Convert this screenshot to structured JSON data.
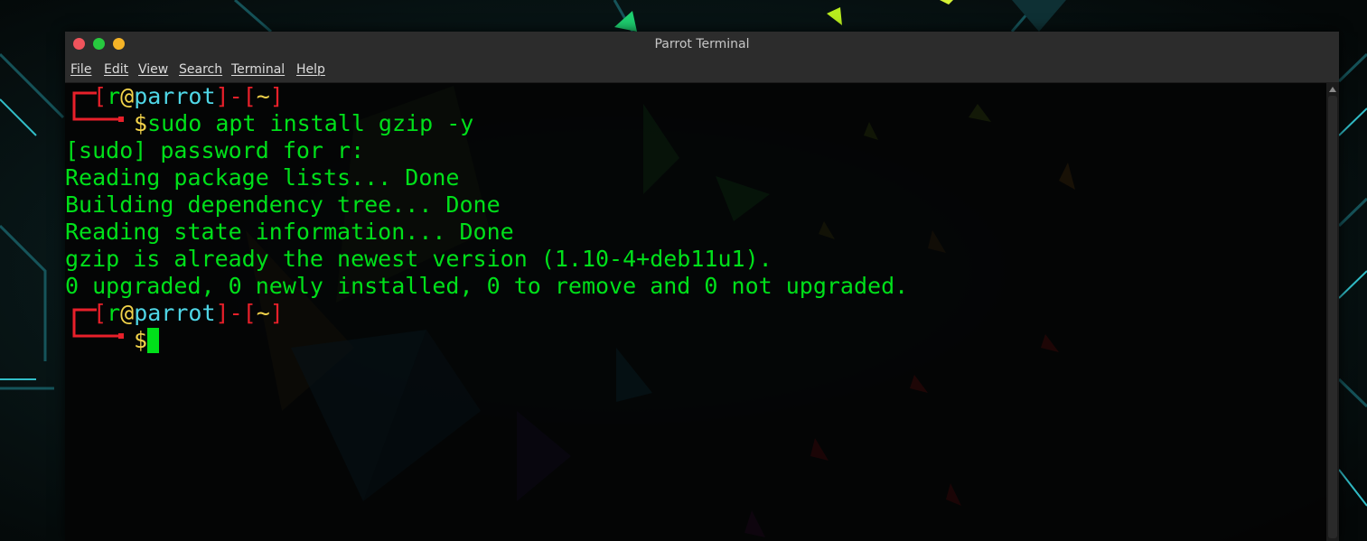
{
  "window": {
    "title": "Parrot Terminal"
  },
  "menu": {
    "file": "File",
    "edit": "Edit",
    "view": "View",
    "search": "Search",
    "terminal": "Terminal",
    "help": "Help"
  },
  "prompt": {
    "open_bracket": "[",
    "user": "r",
    "at": "@",
    "host": "parrot",
    "close_bracket": "]",
    "dash": "-",
    "cwd": "~",
    "dollar": "$"
  },
  "terminal": {
    "command": "sudo apt install gzip -y",
    "output": [
      "[sudo] password for r:",
      "Reading package lists... Done",
      "Building dependency tree... Done",
      "Reading state information... Done",
      "gzip is already the newest version (1.10-4+deb11u1).",
      "0 upgraded, 0 newly installed, 0 to remove and 0 not upgraded."
    ]
  },
  "colors": {
    "output_green": "#00e01a",
    "prompt_red": "#e8202a",
    "prompt_yellow": "#f2d34a",
    "prompt_cyan": "#4fd6e6",
    "traffic_close": "#f0545c",
    "traffic_min": "#27c93f",
    "traffic_max": "#f5b427"
  },
  "icons": {
    "close": "close-icon",
    "minimize": "minimize-icon",
    "maximize": "maximize-icon",
    "scroll_up": "scroll-up-arrow-icon",
    "prompt_corner": "prompt-corner-icon"
  }
}
